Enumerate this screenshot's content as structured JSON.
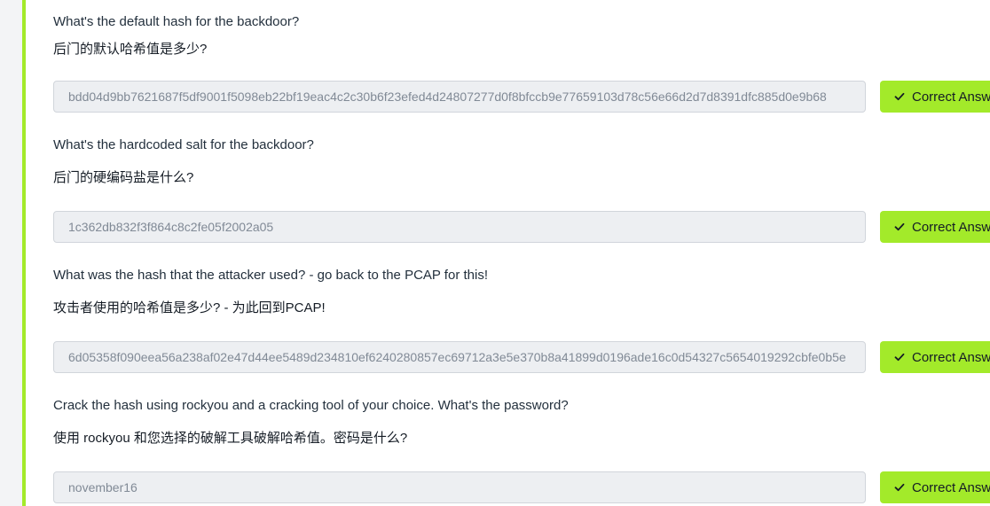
{
  "questions": [
    {
      "question_en": "What's the default hash for the backdoor?",
      "question_zh": "后门的默认哈希值是多少?",
      "answer_value": "bdd04d9bb7621687f5df9001f5098eb22bf19eac4c2c30b6f23efed4d24807277d0f8bfccb9e77659103d78c56e66d2d7d8391dfc885d0e9b68",
      "button_label": "Correct Answer"
    },
    {
      "question_en": "What's the hardcoded salt for the backdoor?",
      "question_zh": "后门的硬编码盐是什么?",
      "answer_value": "1c362db832f3f864c8c2fe05f2002a05",
      "button_label": "Correct Answer"
    },
    {
      "question_en": "What was the hash that the attacker used? - go back to the PCAP for this!",
      "question_zh": "攻击者使用的哈希值是多少? - 为此回到PCAP!",
      "answer_value": "6d05358f090eea56a238af02e47d44ee5489d234810ef6240280857ec69712a3e5e370b8a41899d0196ade16c0d54327c5654019292cbfe0b5e",
      "button_label": "Correct Answer"
    },
    {
      "question_en": "Crack the hash using rockyou and a cracking tool of your choice. What's the password?",
      "question_zh": "使用 rockyou 和您选择的破解工具破解哈希值。密码是什么?",
      "answer_value": "november16",
      "button_label": "Correct Answer"
    }
  ],
  "colors": {
    "accent": "#a3ea2a",
    "input_bg": "#edeff2",
    "input_text": "#818a96"
  },
  "icons": {
    "button_icon": "check-icon"
  }
}
